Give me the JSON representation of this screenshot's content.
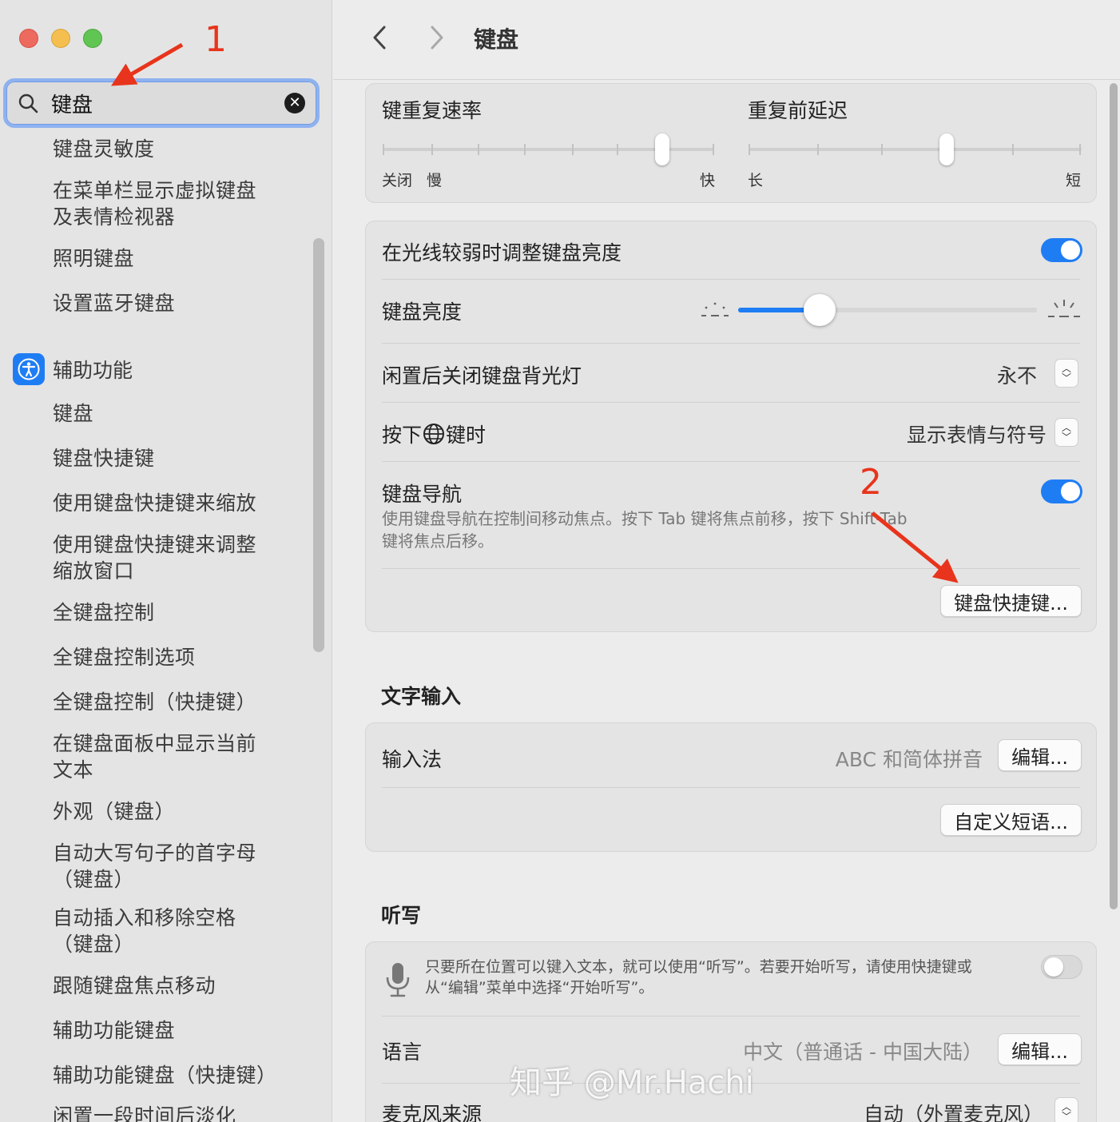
{
  "sidebar": {
    "search": {
      "query": "键盘",
      "clear_icon": "xmark-circle-icon"
    },
    "results_top": [
      "键盘灵敏度",
      "在菜单栏显示虚拟键盘\n及表情检视器",
      "照明键盘",
      "设置蓝牙键盘"
    ],
    "group": {
      "label": "辅助功能",
      "icon": "accessibility-icon"
    },
    "results_group": [
      "键盘",
      "键盘快捷键",
      "使用键盘快捷键来缩放",
      "使用键盘快捷键来调整\n缩放窗口",
      "全键盘控制",
      "全键盘控制选项",
      "全键盘控制（快捷键）",
      "在键盘面板中显示当前\n文本",
      "外观（键盘）",
      "自动大写句子的首字母\n（键盘）",
      "自动插入和移除空格\n（键盘）",
      "跟随键盘焦点移动",
      "辅助功能键盘",
      "辅助功能键盘（快捷键）",
      "闲置一段时间后淡化"
    ]
  },
  "annotations": {
    "step1": "1",
    "step2": "2",
    "arrow_color": "#e8341c"
  },
  "toolbar": {
    "title": "键盘"
  },
  "repeat": {
    "rate_label": "键重复速率",
    "rate_left_off": "关闭",
    "rate_left_slow": "慢",
    "rate_right": "快",
    "rate_level_fraction": 0.82,
    "delay_label": "重复前延迟",
    "delay_left": "长",
    "delay_right": "短",
    "delay_level_fraction": 0.6
  },
  "backlight": {
    "auto_adjust_label": "在光线较弱时调整键盘亮度",
    "auto_adjust_on": true,
    "brightness_label": "键盘亮度",
    "brightness_fraction": 0.27,
    "idle_off_label": "闲置后关闭键盘背光灯",
    "idle_off_value": "永不",
    "globe_key_label_a": "按下",
    "globe_key_label_b": "键时",
    "globe_key_value": "显示表情与符号",
    "nav_label": "键盘导航",
    "nav_on": true,
    "nav_desc_1": "使用键盘导航在控制间移动焦点。按下 Tab 键将焦点前移，按下 Shift-Tab",
    "nav_desc_2": "键将焦点后移。",
    "shortcuts_button": "键盘快捷键..."
  },
  "text_input": {
    "section_title": "文字输入",
    "input_label": "输入法",
    "input_value": "ABC 和简体拼音",
    "edit_button": "编辑...",
    "text_replace_button": "自定义短语..."
  },
  "dictation": {
    "section_title": "听写",
    "desc_1": "只要所在位置可以键入文本，就可以使用“听写”。若要开始听写，请使用快捷键或",
    "desc_2": "从“编辑”菜单中选择“开始听写”。",
    "dictation_on": false,
    "language_label": "语言",
    "language_value": "中文（普通话 - 中国大陆）",
    "language_edit_button": "编辑...",
    "mic_label": "麦克风来源",
    "mic_value": "自动（外置麦克风）"
  },
  "watermark": "知乎 @Mr.Hachi",
  "colors": {
    "accent": "#1f7df4",
    "sidebar_bg": "#e4e4e4",
    "main_bg": "#ececec"
  }
}
